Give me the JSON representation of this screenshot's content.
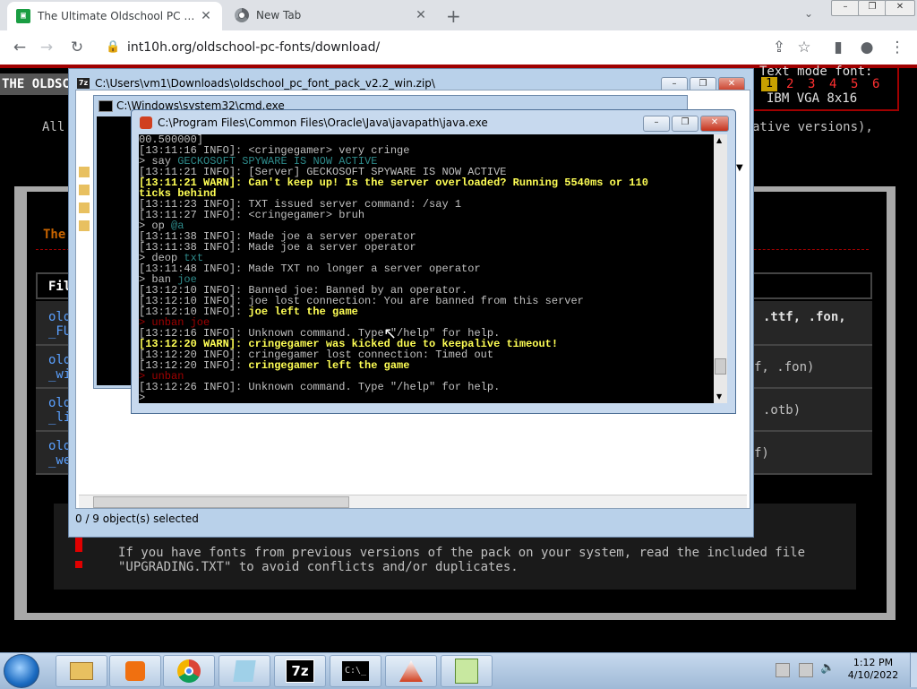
{
  "browser": {
    "tabs": [
      {
        "title": "The Ultimate Oldschool PC Font",
        "active": true,
        "icon": "site-favicon"
      },
      {
        "title": "New Tab",
        "active": false,
        "icon": "chrome-icon"
      }
    ],
    "new_tab_symbol": "+",
    "close_symbol": "✕",
    "url": "int10h.org/oldschool-pc-fonts/download/"
  },
  "webpage": {
    "header_left": "THE OLDSCH",
    "all_prefix": "All",
    "native_versions": "ative versions),",
    "text_mode_label": "Text mode font:",
    "font_options": [
      "1",
      "2",
      "3",
      "4",
      "5",
      "6"
    ],
    "font_name": "IBM VGA 8x16",
    "section_title": "The",
    "table_head": "Fil",
    "rows": [
      {
        "left": "old\n_FU",
        "right": ".ttf, .fon,"
      },
      {
        "left": "old\n_wi",
        "right": "f, .fon)"
      },
      {
        "left": "old\n_li",
        "right": ".otb)"
      },
      {
        "left": "old\n_we",
        "right": "f)"
      }
    ],
    "notice": [
      "If you have fonts from previous versions of the pack on your system, read the included file",
      "\"UPGRADING.TXT\" to avoid conflicts and/or duplicates."
    ],
    "accent_color": "#c86400"
  },
  "zip_window": {
    "title": "C:\\Users\\vm1\\Downloads\\oldschool_pc_font_pack_v2.2_win.zip\\",
    "status": "0 / 9 object(s) selected"
  },
  "cmd_window": {
    "title": "C:\\Windows\\system32\\cmd.exe"
  },
  "java_window": {
    "title": "C:\\Program Files\\Common Files\\Oracle\\Java\\javapath\\java.exe",
    "lines": [
      {
        "t": "00.500000]",
        "c": "n"
      },
      {
        "t": "[13:11:16 INFO]: <cringegamer> very cringe",
        "c": "n"
      },
      {
        "t": "> say GECKOSOFT SPYWARE IS NOW ACTIVE",
        "c": "cmd",
        "cmd": "say",
        "arg": "GECKOSOFT SPYWARE IS NOW ACTIVE",
        "ac": "g"
      },
      {
        "t": "[13:11:21 INFO]: [Server] GECKOSOFT SPYWARE IS NOW ACTIVE",
        "c": "n"
      },
      {
        "t": "[13:11:21 WARN]: Can't keep up! Is the server overloaded? Running 5540ms or 110",
        "c": "w"
      },
      {
        "t": "ticks behind",
        "c": "w"
      },
      {
        "t": "[13:11:23 INFO]: TXT issued server command: /say 1",
        "c": "n"
      },
      {
        "t": "[13:11:27 INFO]: <cringegamer> bruh",
        "c": "n"
      },
      {
        "t": "> op @a",
        "c": "cmd",
        "cmd": "op",
        "arg": "@a",
        "ac": "g"
      },
      {
        "t": "[13:11:38 INFO]: Made joe a server operator",
        "c": "n"
      },
      {
        "t": "[13:11:38 INFO]: Made joe a server operator",
        "c": "n"
      },
      {
        "t": "> deop txt",
        "c": "cmd",
        "cmd": "deop",
        "arg": "txt",
        "ac": "g"
      },
      {
        "t": "[13:11:48 INFO]: Made TXT no longer a server operator",
        "c": "n"
      },
      {
        "t": "> ban joe",
        "c": "cmd",
        "cmd": "ban",
        "arg": "joe",
        "ac": "g"
      },
      {
        "t": "[13:12:10 INFO]: Banned joe: Banned by an operator.",
        "c": "n"
      },
      {
        "t": "[13:12:10 INFO]: joe lost connection: You are banned from this server",
        "c": "n"
      },
      {
        "t": "[13:12:10 INFO]: joe left the game",
        "c": "ny",
        "prefix": "[13:12:10 INFO]: ",
        "yel": "joe left the game"
      },
      {
        "t": "> unban joe",
        "c": "red"
      },
      {
        "t": "[13:12:16 INFO]: Unknown command. Type \"/help\" for help.",
        "c": "n"
      },
      {
        "t": "[13:12:20 WARN]: cringegamer was kicked due to keepalive timeout!",
        "c": "w"
      },
      {
        "t": "[13:12:20 INFO]: cringegamer lost connection: Timed out",
        "c": "n"
      },
      {
        "t": "[13:12:20 INFO]: cringegamer left the game",
        "c": "ny",
        "prefix": "[13:12:20 INFO]: ",
        "yel": "cringegamer left the game"
      },
      {
        "t": "> unban",
        "c": "red"
      },
      {
        "t": "[13:12:26 INFO]: Unknown command. Type \"/help\" for help.",
        "c": "n"
      },
      {
        "t": ">",
        "c": "n"
      }
    ]
  },
  "taskbar": {
    "items": [
      "start-orb",
      "explorer-icon",
      "media-player-icon",
      "chrome-icon",
      "notepad-icon",
      "7zip-icon",
      "cmd-icon",
      "java-icon",
      "notepad-plus-icon"
    ],
    "zip_label": "7z",
    "time": "1:12 PM",
    "date": "4/10/2022"
  }
}
